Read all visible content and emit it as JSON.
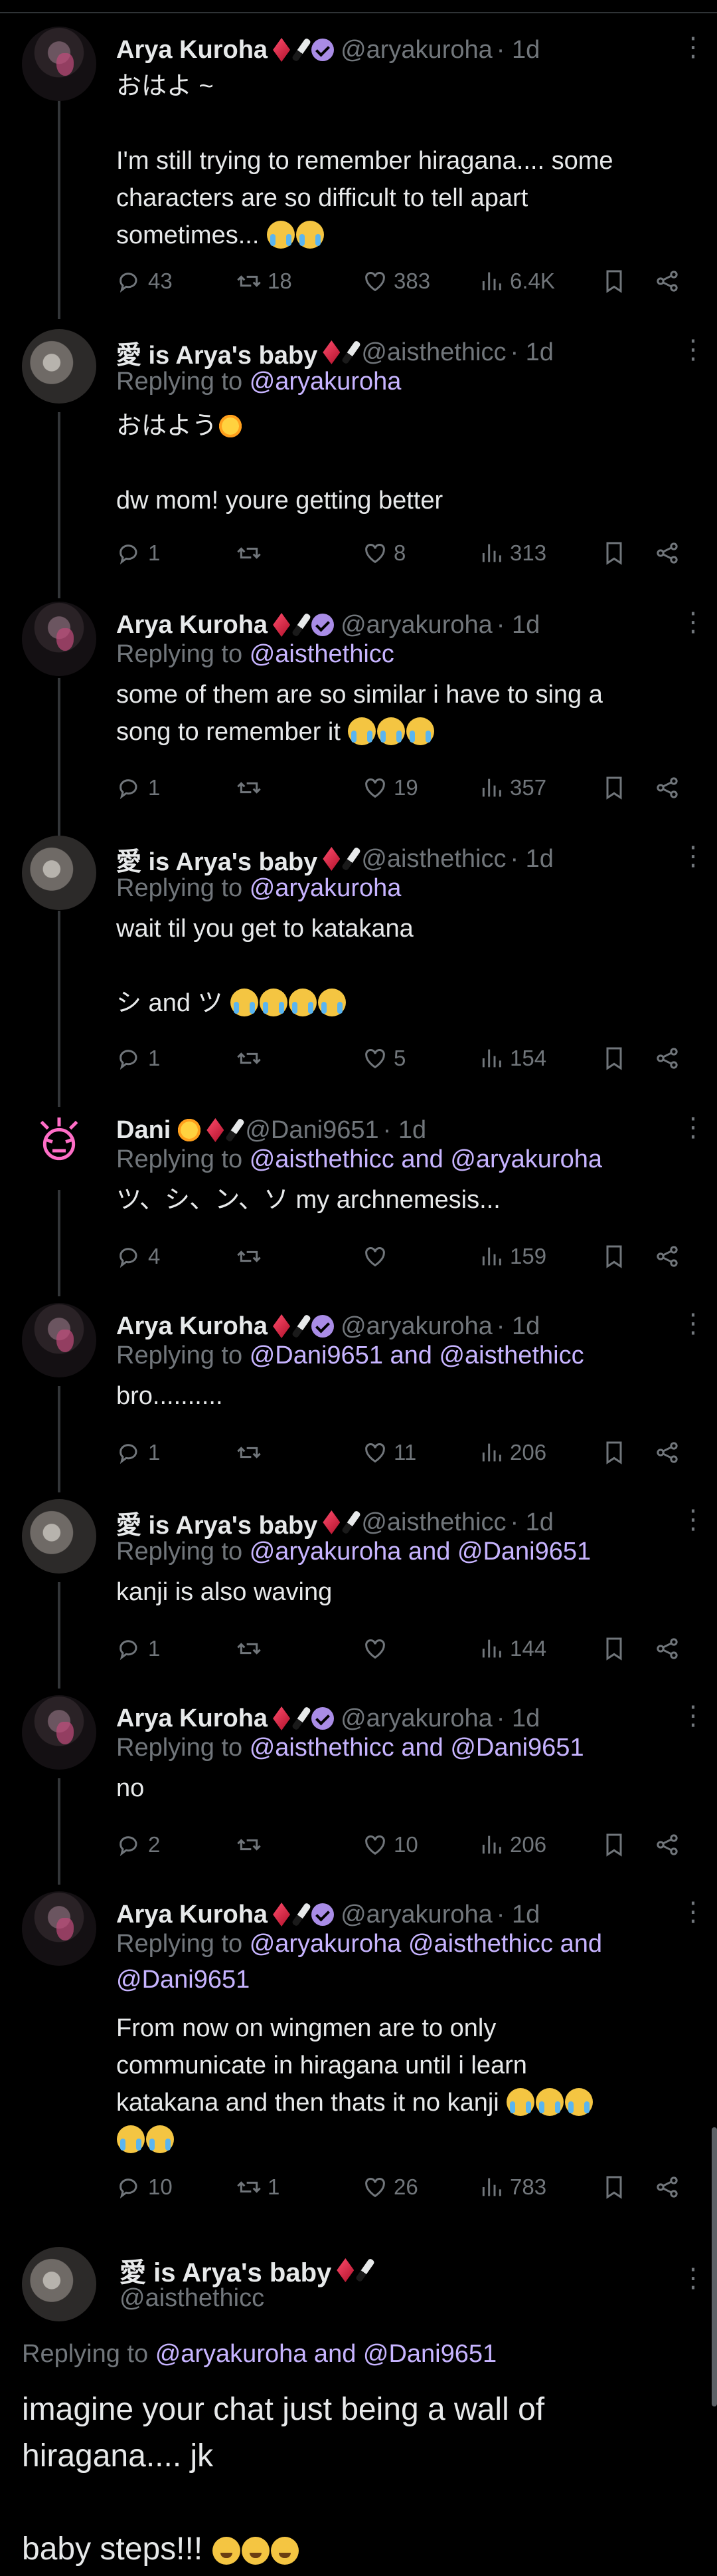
{
  "users": {
    "arya": {
      "name": "Arya Kuroha",
      "handle": "@aryakuroha"
    },
    "ais": {
      "name": "愛 is Arya's baby",
      "handle": "@aisthethicc"
    },
    "dani": {
      "name": "Dani",
      "handle": "@Dani9651"
    }
  },
  "colors": {
    "accent": "#c7b4ff",
    "muted": "#71767b",
    "verified": "#a98ce6",
    "background": "#000000"
  },
  "tweets": [
    {
      "name": "Arya Kuroha",
      "handle": "@aryakuroha",
      "time": "· 1d",
      "reply": "",
      "body_lines": [
        "おはよ ~",
        "",
        "I'm still trying to remember hiragana.... some",
        "characters are so difficult to tell apart",
        "sometimes..."
      ],
      "replies": "43",
      "retweets": "18",
      "likes": "383",
      "views": "6.4K"
    },
    {
      "name": "愛 is Arya's baby",
      "handle": "@aisthethicc",
      "time": "· 1d",
      "reply_prefix": "Replying to",
      "reply": "@aryakuroha",
      "body_lines": [
        "おはよう",
        "",
        "dw mom! youre getting better"
      ],
      "replies": "1",
      "retweets": "",
      "likes": "8",
      "views": "313"
    },
    {
      "name": "Arya Kuroha",
      "handle": "@aryakuroha",
      "time": "· 1d",
      "reply_prefix": "Replying to",
      "reply": "@aisthethicc",
      "body_lines": [
        "some of them are so similar i have to sing a",
        "song to remember it"
      ],
      "replies": "1",
      "retweets": "",
      "likes": "19",
      "views": "357"
    },
    {
      "name": "愛 is Arya's baby",
      "handle": "@aisthethicc",
      "time": "· 1d",
      "reply_prefix": "Replying to",
      "reply": "@aryakuroha",
      "body_lines": [
        "wait til you get to katakana",
        "",
        "シ and ツ"
      ],
      "replies": "1",
      "retweets": "",
      "likes": "5",
      "views": "154"
    },
    {
      "name": "Dani",
      "handle": "@Dani9651",
      "time": "· 1d",
      "reply_prefix": "Replying to",
      "reply": "@aisthethicc and @aryakuroha",
      "body_lines": [
        "ツ、シ、ン、ソ my archnemesis..."
      ],
      "replies": "4",
      "retweets": "",
      "likes": "",
      "views": "159"
    },
    {
      "name": "Arya Kuroha",
      "handle": "@aryakuroha",
      "time": "· 1d",
      "reply_prefix": "Replying to",
      "reply": "@Dani9651 and @aisthethicc",
      "body_lines": [
        "bro.........."
      ],
      "replies": "1",
      "retweets": "",
      "likes": "11",
      "views": "206"
    },
    {
      "name": "愛 is Arya's baby",
      "handle": "@aisthethicc",
      "time": "· 1d",
      "reply_prefix": "Replying to",
      "reply": "@aryakuroha and @Dani9651",
      "body_lines": [
        "kanji is also waving"
      ],
      "replies": "1",
      "retweets": "",
      "likes": "",
      "views": "144"
    },
    {
      "name": "Arya Kuroha",
      "handle": "@aryakuroha",
      "time": "· 1d",
      "reply_prefix": "Replying to",
      "reply": "@aisthethicc and @Dani9651",
      "body_lines": [
        "no"
      ],
      "replies": "2",
      "retweets": "",
      "likes": "10",
      "views": "206"
    },
    {
      "name": "Arya Kuroha",
      "handle": "@aryakuroha",
      "time": "· 1d",
      "reply_prefix": "Replying to",
      "reply": "@aryakuroha @aisthethicc and",
      "reply2": "@Dani9651",
      "body_lines": [
        "From now on wingmen are to only",
        "communicate in hiragana until i learn",
        "katakana and then thats it no kanji"
      ],
      "replies": "10",
      "retweets": "1",
      "likes": "26",
      "views": "783"
    }
  ],
  "main_tweet": {
    "name": "愛 is Arya's baby",
    "handle": "@aisthethicc",
    "reply_prefix": "Replying to",
    "reply": "@aryakuroha and @Dani9651",
    "body_lines": [
      "imagine your chat just being a wall of",
      "hiragana.... jk",
      "",
      "baby steps!!!"
    ]
  },
  "icons": {
    "reply": "reply-icon",
    "retweet": "retweet-icon",
    "like": "heart-icon",
    "views": "views-icon",
    "bookmark": "bookmark-icon",
    "share": "share-icon",
    "more": "more-icon",
    "verified": "verified-badge-icon"
  }
}
